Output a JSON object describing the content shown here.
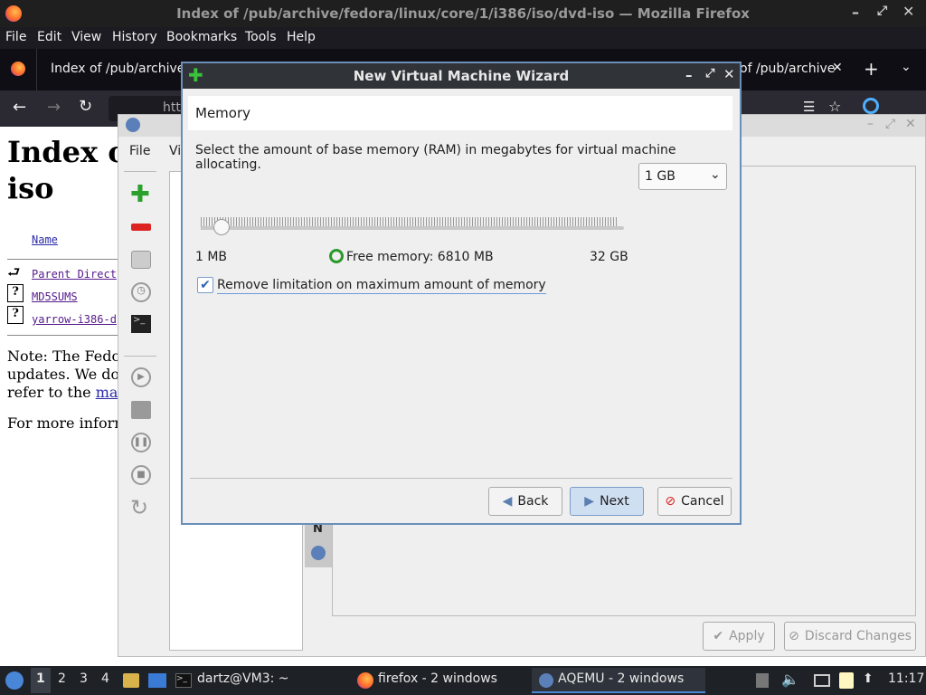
{
  "firefox": {
    "window_title": "Index of /pub/archive/fedora/linux/core/1/i386/iso/dvd-iso — Mozilla Firefox",
    "menu": [
      "File",
      "Edit",
      "View",
      "History",
      "Bookmarks",
      "Tools",
      "Help"
    ],
    "tab1_label": "Index of /pub/archive",
    "tab2_label": "of /pub/archive",
    "url_partial": "htt",
    "page": {
      "heading_line1": "Index o",
      "heading_line2": "iso",
      "col_name": "Name",
      "rows": [
        "Parent Direct",
        "MD5SUMS",
        "yarrow-i386-d"
      ],
      "note_line1": "Note: The Fedo",
      "note_line2": "updates. We do",
      "note_line3_prefix": "refer to the ",
      "note_line3_link": "ma",
      "more_info": "For more inforr"
    }
  },
  "aqemu": {
    "menu": [
      "File",
      "Vi"
    ],
    "apply_label": "Apply",
    "discard_label": "Discard Changes",
    "side_tab_text": "N"
  },
  "wizard": {
    "title": "New Virtual Machine Wizard",
    "section_title": "Memory",
    "description": "Select the amount of base memory (RAM) in megabytes for virtual machine allocating.",
    "memory_select": "1 GB",
    "min_label": "1 MB",
    "free_memory": "Free memory: 6810 MB",
    "max_label": "32 GB",
    "slider_fraction": 0.031,
    "checkbox_label": "Remove limitation on maximum amount of memory",
    "checkbox_checked": true,
    "back_label": "Back",
    "next_label": "Next",
    "cancel_label": "Cancel"
  },
  "taskbar": {
    "workspaces": [
      "1",
      "2",
      "3",
      "4"
    ],
    "terminal": "dartz@VM3: ~",
    "firefox": "firefox - 2 windows",
    "aqemu": "AQEMU - 2 windows",
    "clock": "11:17"
  }
}
